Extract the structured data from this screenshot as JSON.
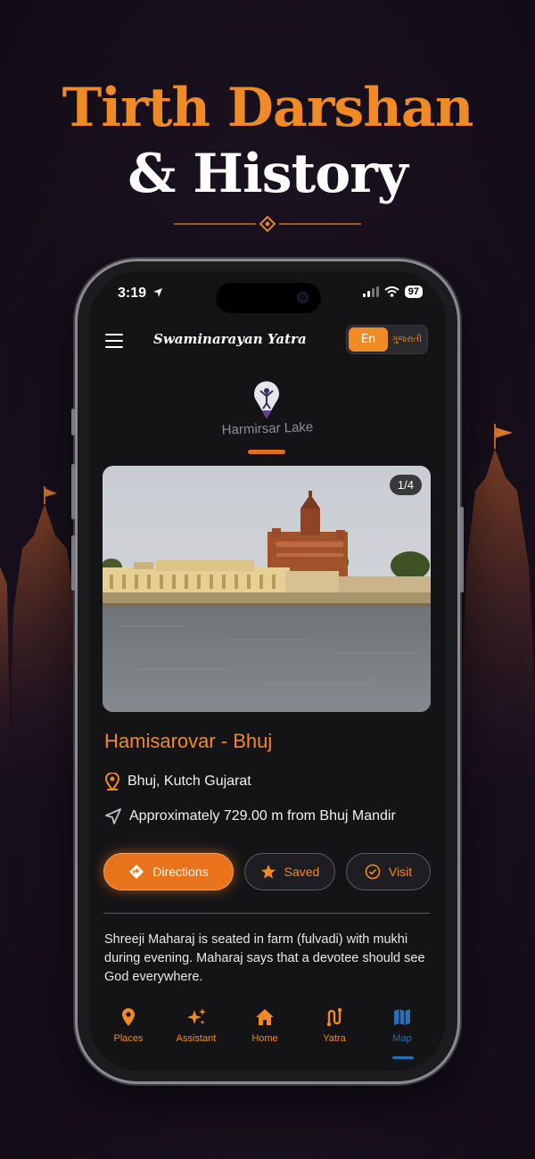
{
  "promo": {
    "title_line1": "Tirth Darshan",
    "title_line2": "& History"
  },
  "status_bar": {
    "time": "3:19",
    "battery": "97"
  },
  "header": {
    "brand": "Swaminarayan Yatra",
    "lang_en": "En",
    "lang_gu": "ગુજરાતી"
  },
  "map_pin": {
    "label": "Harmirsar Lake"
  },
  "place": {
    "image_counter": "1/4",
    "title": "Hamisarovar - Bhuj",
    "location": "Bhuj, Kutch Gujarat",
    "distance": "Approximately 729.00 m from Bhuj Mandir",
    "description": "Shreeji Maharaj is seated in farm (fulvadi) with mukhi during evening. Maharaj says that a devotee should see God everywhere."
  },
  "actions": {
    "directions": "Directions",
    "saved": "Saved",
    "visit": "Visit"
  },
  "tabs": [
    {
      "label": "Places",
      "icon": "location-pin-icon"
    },
    {
      "label": "Assistant",
      "icon": "sparkles-icon"
    },
    {
      "label": "Home",
      "icon": "home-icon"
    },
    {
      "label": "Yatra",
      "icon": "route-icon"
    },
    {
      "label": "Map",
      "icon": "map-icon"
    }
  ],
  "active_tab": "Map",
  "colors": {
    "accent": "#f08a24",
    "active_tab": "#2a6fb5",
    "background": "#141416"
  }
}
